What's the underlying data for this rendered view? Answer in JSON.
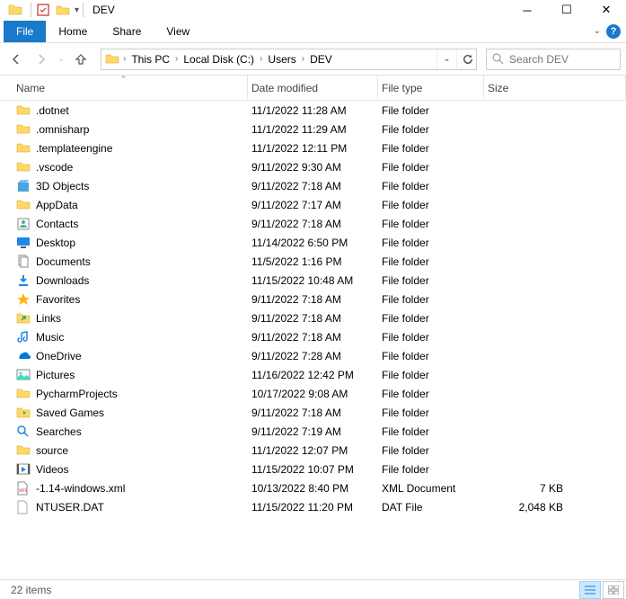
{
  "window": {
    "title": "DEV"
  },
  "ribbon": {
    "file": "File",
    "home": "Home",
    "share": "Share",
    "view": "View"
  },
  "breadcrumb": {
    "b0": "This PC",
    "b1": "Local Disk (C:)",
    "b2": "Users",
    "b3": "DEV"
  },
  "search": {
    "placeholder": "Search DEV"
  },
  "columns": {
    "name": "Name",
    "date": "Date modified",
    "type": "File type",
    "size": "Size"
  },
  "files": [
    {
      "icon": "folder",
      "name": ".dotnet",
      "date": "11/1/2022 11:28 AM",
      "type": "File folder",
      "size": ""
    },
    {
      "icon": "folder",
      "name": ".omnisharp",
      "date": "11/1/2022 11:29 AM",
      "type": "File folder",
      "size": ""
    },
    {
      "icon": "folder",
      "name": ".templateengine",
      "date": "11/1/2022 12:11 PM",
      "type": "File folder",
      "size": ""
    },
    {
      "icon": "folder",
      "name": ".vscode",
      "date": "9/11/2022 9:30 AM",
      "type": "File folder",
      "size": ""
    },
    {
      "icon": "3d",
      "name": "3D Objects",
      "date": "9/11/2022 7:18 AM",
      "type": "File folder",
      "size": ""
    },
    {
      "icon": "folder",
      "name": "AppData",
      "date": "9/11/2022 7:17 AM",
      "type": "File folder",
      "size": ""
    },
    {
      "icon": "contacts",
      "name": "Contacts",
      "date": "9/11/2022 7:18 AM",
      "type": "File folder",
      "size": ""
    },
    {
      "icon": "desktop",
      "name": "Desktop",
      "date": "11/14/2022 6:50 PM",
      "type": "File folder",
      "size": ""
    },
    {
      "icon": "documents",
      "name": "Documents",
      "date": "11/5/2022 1:16 PM",
      "type": "File folder",
      "size": ""
    },
    {
      "icon": "downloads",
      "name": "Downloads",
      "date": "11/15/2022 10:48 AM",
      "type": "File folder",
      "size": ""
    },
    {
      "icon": "favorites",
      "name": "Favorites",
      "date": "9/11/2022 7:18 AM",
      "type": "File folder",
      "size": ""
    },
    {
      "icon": "links",
      "name": "Links",
      "date": "9/11/2022 7:18 AM",
      "type": "File folder",
      "size": ""
    },
    {
      "icon": "music",
      "name": "Music",
      "date": "9/11/2022 7:18 AM",
      "type": "File folder",
      "size": ""
    },
    {
      "icon": "onedrive",
      "name": "OneDrive",
      "date": "9/11/2022 7:28 AM",
      "type": "File folder",
      "size": ""
    },
    {
      "icon": "pictures",
      "name": "Pictures",
      "date": "11/16/2022 12:42 PM",
      "type": "File folder",
      "size": ""
    },
    {
      "icon": "folder",
      "name": "PycharmProjects",
      "date": "10/17/2022 9:08 AM",
      "type": "File folder",
      "size": ""
    },
    {
      "icon": "saved",
      "name": "Saved Games",
      "date": "9/11/2022 7:18 AM",
      "type": "File folder",
      "size": ""
    },
    {
      "icon": "searches",
      "name": "Searches",
      "date": "9/11/2022 7:19 AM",
      "type": "File folder",
      "size": ""
    },
    {
      "icon": "folder",
      "name": "source",
      "date": "11/1/2022 12:07 PM",
      "type": "File folder",
      "size": ""
    },
    {
      "icon": "videos",
      "name": "Videos",
      "date": "11/15/2022 10:07 PM",
      "type": "File folder",
      "size": ""
    },
    {
      "icon": "xml",
      "name": "-1.14-windows.xml",
      "date": "10/13/2022 8:40 PM",
      "type": "XML Document",
      "size": "7 KB"
    },
    {
      "icon": "file",
      "name": "NTUSER.DAT",
      "date": "11/15/2022 11:20 PM",
      "type": "DAT File",
      "size": "2,048 KB"
    }
  ],
  "status": {
    "count": "22 items"
  }
}
